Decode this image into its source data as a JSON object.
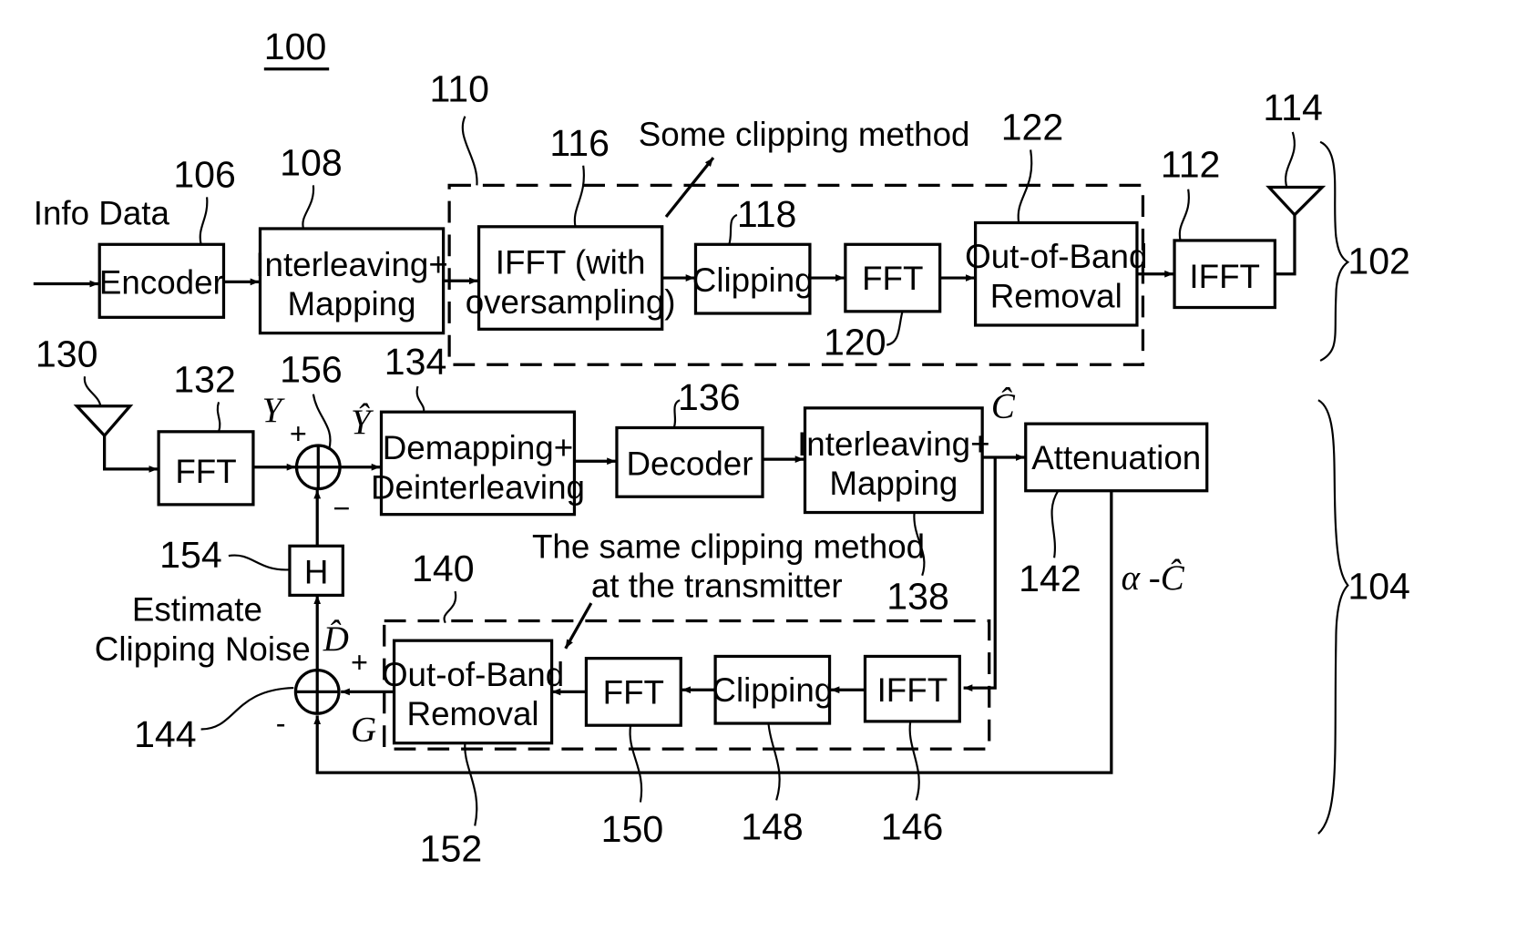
{
  "figure": {
    "number": "100",
    "transmitter_ref": "102",
    "receiver_ref": "104"
  },
  "transmitter": {
    "input_label": "Info Data",
    "encoder": {
      "ref": "106",
      "label": "Encoder"
    },
    "interleaving_mapping": {
      "ref": "108",
      "label_line1": "Interleaving+",
      "label_line2": "Mapping"
    },
    "clipping_block": {
      "ref": "110",
      "annotation": "Some clipping method"
    },
    "ifft_oversampling": {
      "ref": "116",
      "label_line1": "IFFT (with",
      "label_line2": "oversampling)"
    },
    "clipping": {
      "ref": "118",
      "label": "Clipping"
    },
    "fft": {
      "ref": "120",
      "label": "FFT"
    },
    "out_of_band_removal": {
      "ref": "122",
      "label_line1": "Out-of-Band",
      "label_line2": "Removal"
    },
    "ifft": {
      "ref": "112",
      "label": "IFFT"
    },
    "antenna": {
      "ref": "114"
    }
  },
  "receiver": {
    "antenna": {
      "ref": "130"
    },
    "fft": {
      "ref": "132",
      "label": "FFT"
    },
    "signal_y": "Y",
    "signal_y_hat": "Ŷ",
    "summer_top": {
      "ref": "156",
      "plus": "+",
      "minus": "−"
    },
    "demapping": {
      "ref": "134",
      "label_line1": "Demapping+",
      "label_line2": "Deinterleaving"
    },
    "decoder": {
      "ref": "136",
      "label": "Decoder"
    },
    "interleaving_mapping": {
      "ref": "138",
      "label_line1": "Interleaving+",
      "label_line2": "Mapping"
    },
    "signal_c_hat": "Ĉ",
    "attenuation": {
      "ref": "142",
      "label": "Attenuation"
    },
    "signal_alpha_c": "α -Ĉ",
    "h_block": {
      "ref": "154",
      "label": "H"
    },
    "estimate_label_line1": "Estimate",
    "estimate_label_line2": "Clipping Noise",
    "signal_d_hat": "D̂",
    "signal_g": "G",
    "summer_bottom": {
      "ref": "144",
      "plus": "+",
      "minus": "-"
    },
    "replica_block": {
      "ref": "140",
      "annotation_line1": "The same clipping method",
      "annotation_line2": "at the transmitter"
    },
    "out_of_band_removal": {
      "ref": "152",
      "label_line1": "Out-of-Band",
      "label_line2": "Removal"
    },
    "fft2": {
      "ref": "150",
      "label": "FFT"
    },
    "clipping": {
      "ref": "148",
      "label": "Clipping"
    },
    "ifft": {
      "ref": "146",
      "label": "IFFT"
    }
  }
}
